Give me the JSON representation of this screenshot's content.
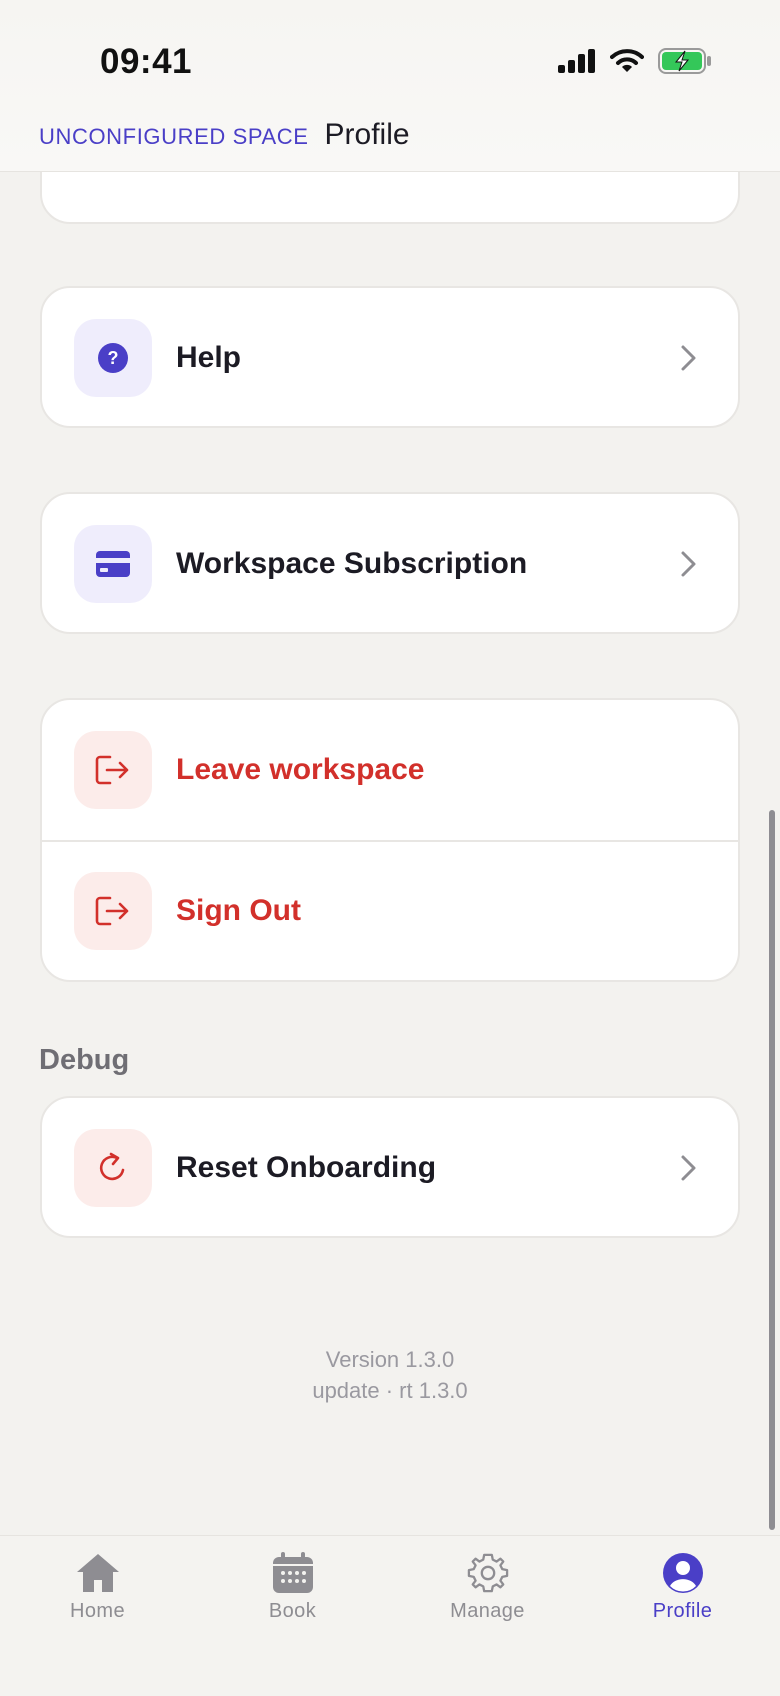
{
  "status_bar": {
    "time": "09:41"
  },
  "header": {
    "space_name": "UNCONFIGURED SPACE",
    "title": "Profile"
  },
  "items": {
    "help": {
      "label": "Help",
      "icon": "help-circle-icon"
    },
    "subscription": {
      "label": "Workspace Subscription",
      "icon": "credit-card-icon"
    },
    "leave": {
      "label": "Leave workspace",
      "icon": "exit-icon"
    },
    "sign_out": {
      "label": "Sign Out",
      "icon": "exit-icon"
    }
  },
  "debug": {
    "title": "Debug",
    "reset": {
      "label": "Reset Onboarding",
      "icon": "refresh-icon"
    }
  },
  "version": {
    "line1": "Version 1.3.0",
    "line2": "update · rt 1.3.0"
  },
  "tabs": [
    {
      "label": "Home",
      "icon": "home-icon"
    },
    {
      "label": "Book",
      "icon": "calendar-icon"
    },
    {
      "label": "Manage",
      "icon": "gear-icon"
    },
    {
      "label": "Profile",
      "icon": "user-icon",
      "active": true
    }
  ],
  "colors": {
    "accent": "#4A3FC7",
    "danger": "#D2302B",
    "background": "#F3F2EF",
    "muted": "#8E8D92"
  }
}
